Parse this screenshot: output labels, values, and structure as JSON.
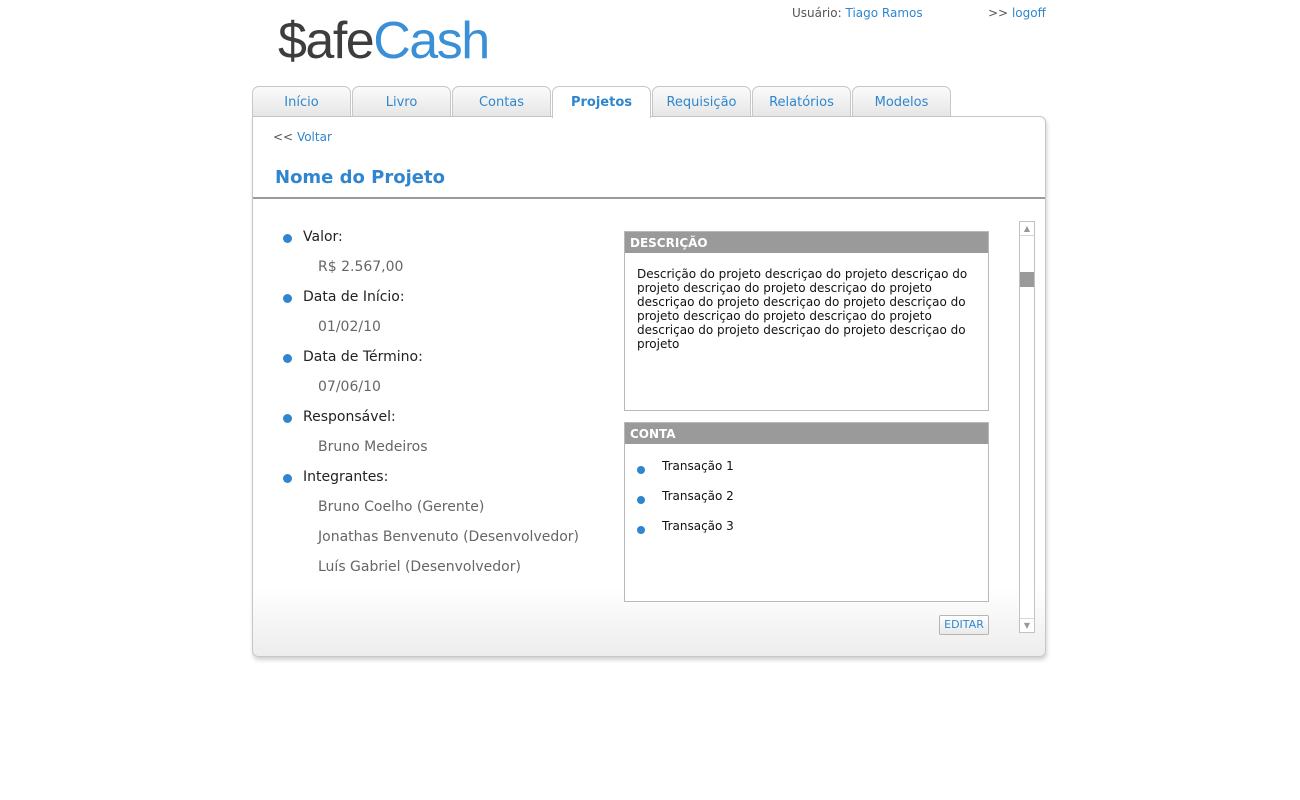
{
  "logo": {
    "part1": "$afe",
    "part2": "Cash"
  },
  "user": {
    "label": "Usuário:",
    "name": "Tiago Ramos"
  },
  "logoff": {
    "prefix": ">>",
    "label": "logoff"
  },
  "tabs": [
    {
      "label": "Início"
    },
    {
      "label": "Livro"
    },
    {
      "label": "Contas"
    },
    {
      "label": "Projetos",
      "active": true
    },
    {
      "label": "Requisição"
    },
    {
      "label": "Relatórios"
    },
    {
      "label": "Modelos"
    }
  ],
  "back": {
    "prefix": "<<",
    "label": "Voltar"
  },
  "project": {
    "title": "Nome do Projeto",
    "fields": [
      {
        "label": "Valor:",
        "values": [
          "R$ 2.567,00"
        ]
      },
      {
        "label": "Data de Início:",
        "values": [
          "01/02/10"
        ]
      },
      {
        "label": "Data de Término:",
        "values": [
          "07/06/10"
        ]
      },
      {
        "label": "Responsável:",
        "values": [
          "Bruno Medeiros"
        ]
      },
      {
        "label": "Integrantes:",
        "values": [
          "Bruno Coelho (Gerente)",
          "Jonathas Benvenuto (Desenvolvedor)",
          "Luís Gabriel (Desenvolvedor)"
        ]
      }
    ]
  },
  "description": {
    "header": "DESCRIÇÃO",
    "text": "Descrição do projeto descriçao do projeto descriçao do projeto descriçao do projeto descriçao do projeto descriçao do projeto descriçao do projeto descriçao do projeto descriçao do projeto descriçao do projeto descriçao do projeto descriçao do projeto descriçao do projeto"
  },
  "conta": {
    "header": "CONTA",
    "transactions": [
      "Transação 1",
      "Transação 2",
      "Transação 3"
    ]
  },
  "edit_button": {
    "label": "EDITAR"
  },
  "colors": {
    "accent": "#2f86cf",
    "header_gray": "#9a9a9a",
    "logo_dark": "#3d3d3d"
  }
}
